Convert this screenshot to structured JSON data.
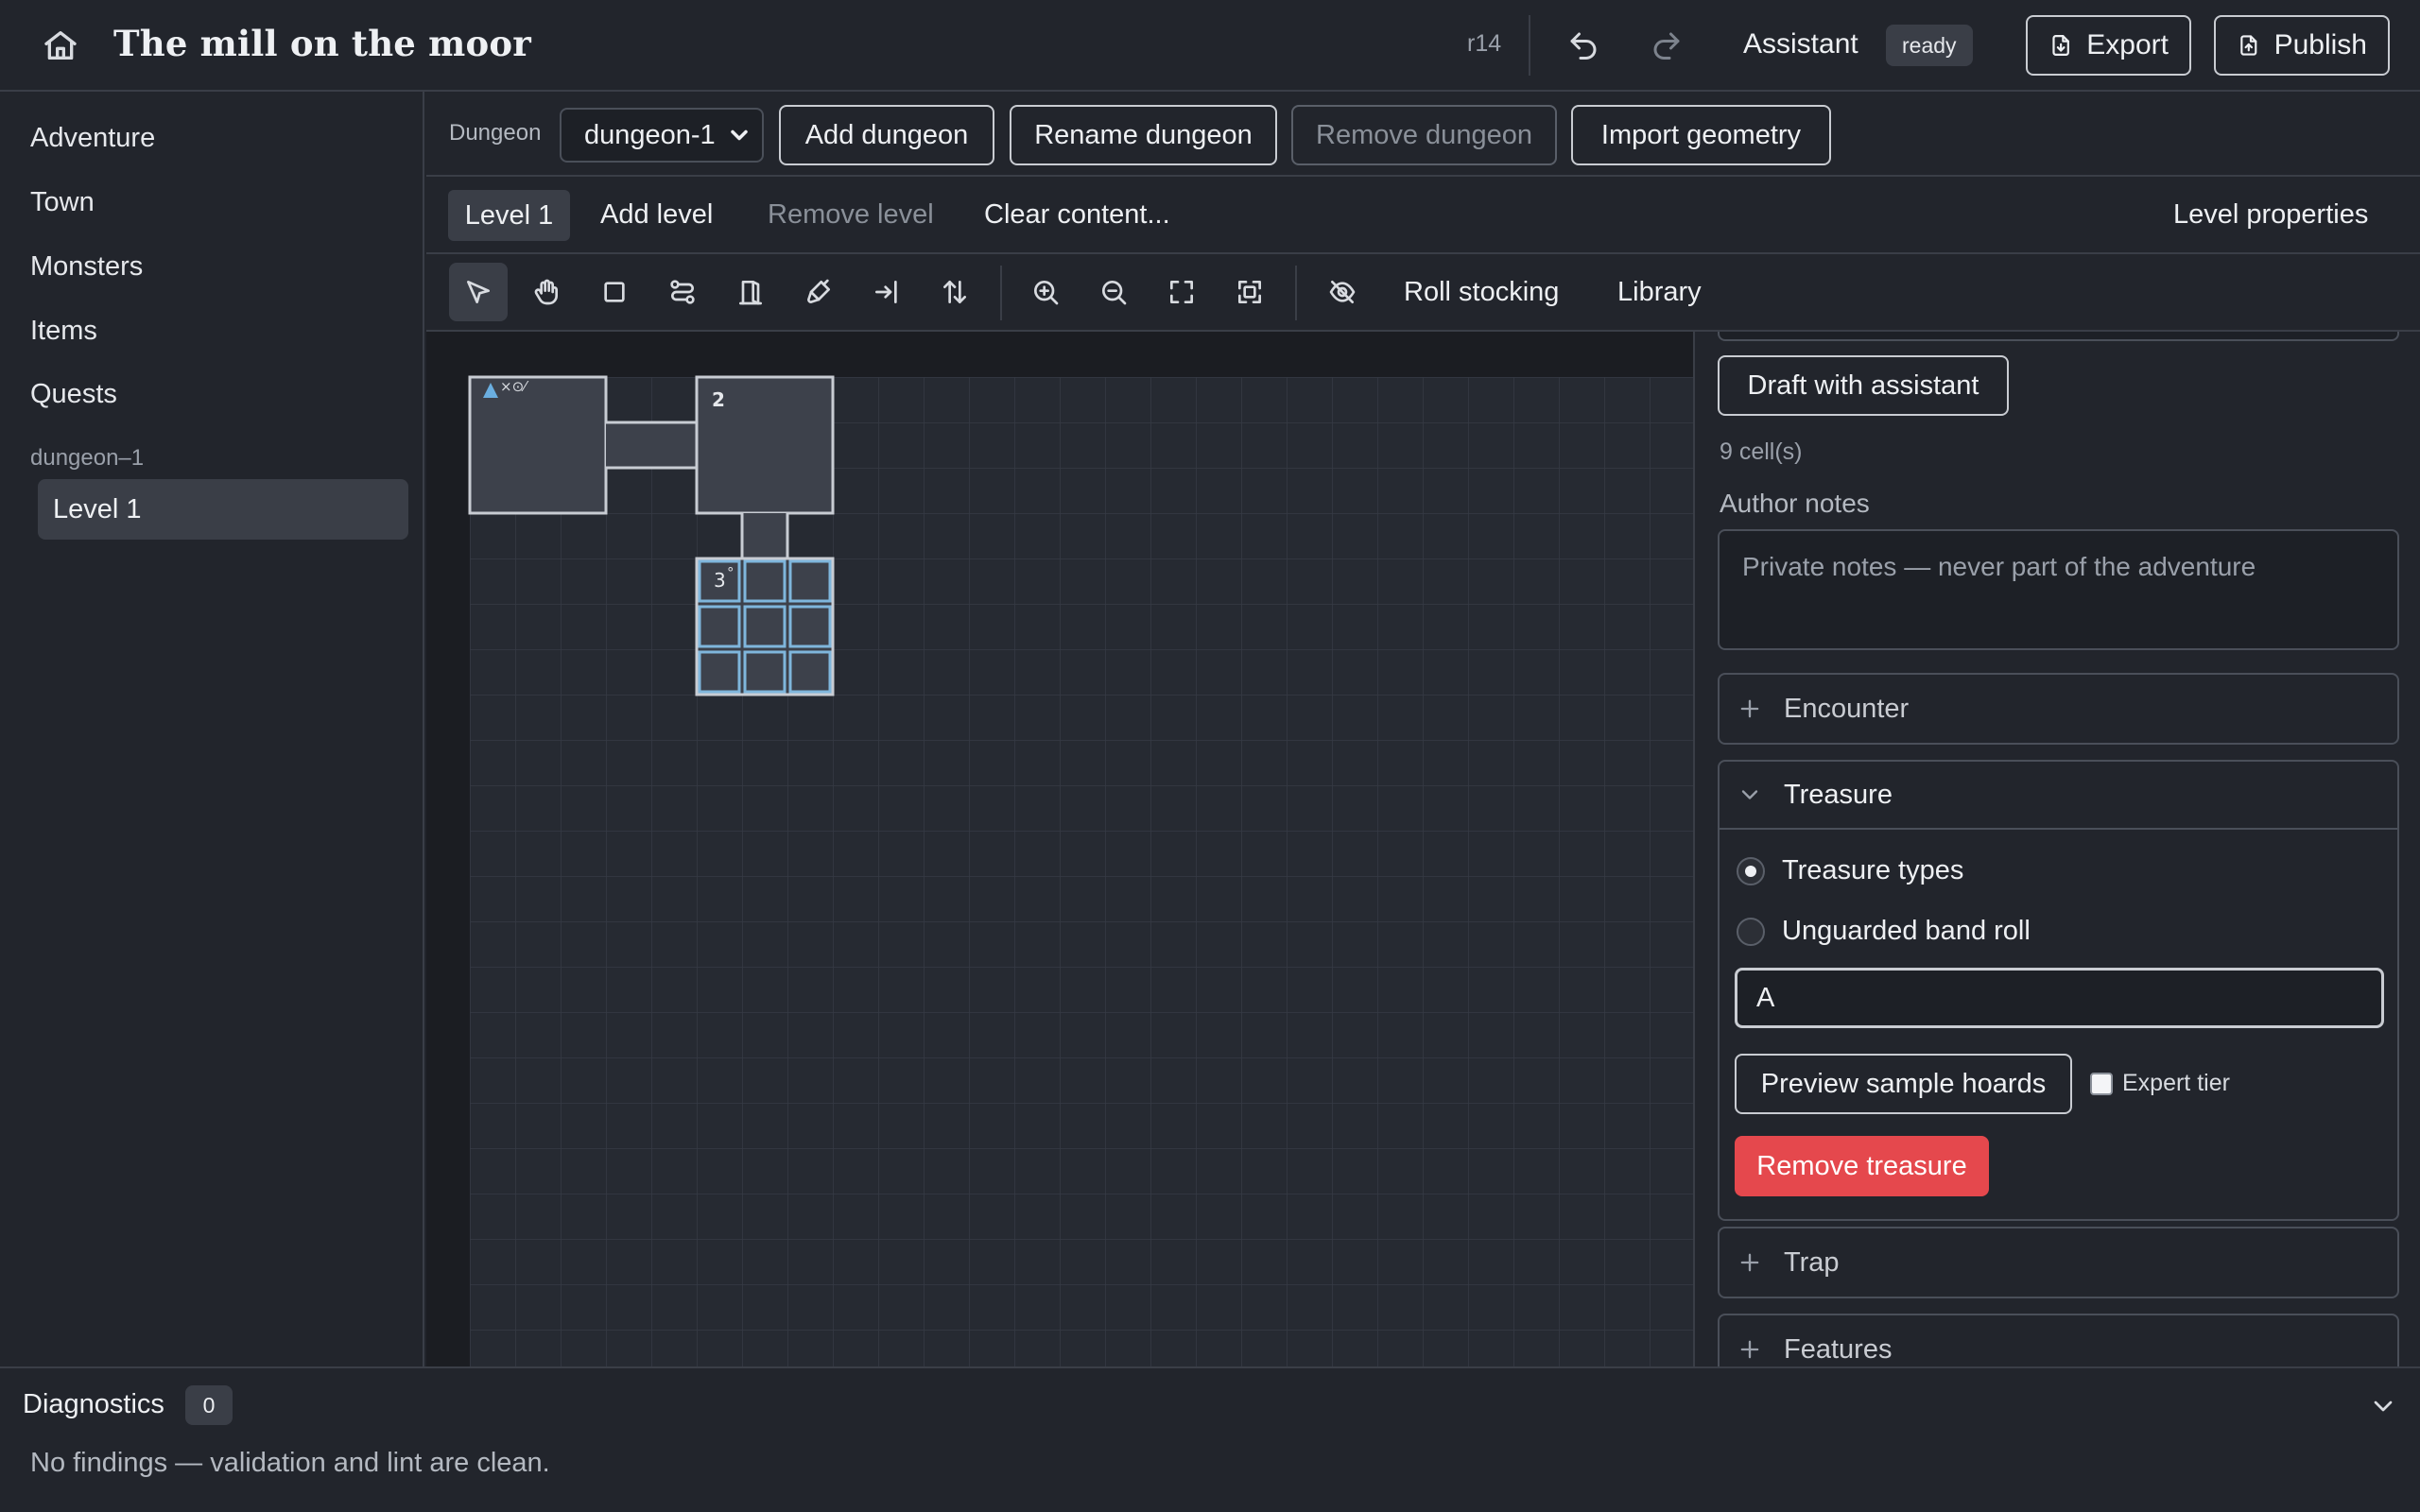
{
  "app": {
    "title": "The mill on the moor",
    "revision": "r14",
    "assistant_label": "Assistant",
    "assistant_status": "ready",
    "export_label": "Export",
    "publish_label": "Publish"
  },
  "sidebar": {
    "items": [
      {
        "label": "Adventure"
      },
      {
        "label": "Town"
      },
      {
        "label": "Monsters"
      },
      {
        "label": "Items"
      },
      {
        "label": "Quests"
      }
    ],
    "group_label": "dungeon–1",
    "active_level": "Level 1"
  },
  "dungeon_bar": {
    "label": "Dungeon",
    "selected": "dungeon-1",
    "add": "Add dungeon",
    "rename": "Rename dungeon",
    "remove": "Remove dungeon",
    "import": "Import geometry"
  },
  "level_bar": {
    "tab": "Level 1",
    "add": "Add level",
    "remove": "Remove level",
    "clear": "Clear content...",
    "properties": "Level properties"
  },
  "toolbar": {
    "tools": [
      "select-tool-icon",
      "pan-tool-icon",
      "room-tool-icon",
      "corridor-tool-icon",
      "door-tool-icon",
      "paint-tool-icon",
      "entrance-tool-icon",
      "stairs-tool-icon",
      "zoom-in-icon",
      "zoom-out-icon",
      "fit-view-icon",
      "fit-selection-icon",
      "hide-icon"
    ],
    "roll_stocking": "Roll stocking",
    "library": "Library"
  },
  "map": {
    "room_labels": [
      "2",
      "3"
    ],
    "room1_marker": "×⊙⁄",
    "room3_marker": "°",
    "entrance_color": "#6aaee0",
    "selection_color": "#7fb6dc"
  },
  "inspector": {
    "draft_label": "Draft with assistant",
    "cell_count": "9 cell(s)",
    "notes_label": "Author notes",
    "notes_placeholder": "Private notes — never part of the adventure",
    "sections": {
      "encounter": "Encounter",
      "treasure": "Treasure",
      "trap": "Trap",
      "features": "Features"
    },
    "treasure": {
      "option_types": "Treasure types",
      "option_band": "Unguarded band roll",
      "value": "A",
      "preview_label": "Preview sample hoards",
      "expert_label": "Expert tier",
      "remove_label": "Remove treasure",
      "remove_color": "#e5484d"
    }
  },
  "diagnostics": {
    "title": "Diagnostics",
    "count": "0",
    "message": "No findings — validation and lint are clean."
  }
}
